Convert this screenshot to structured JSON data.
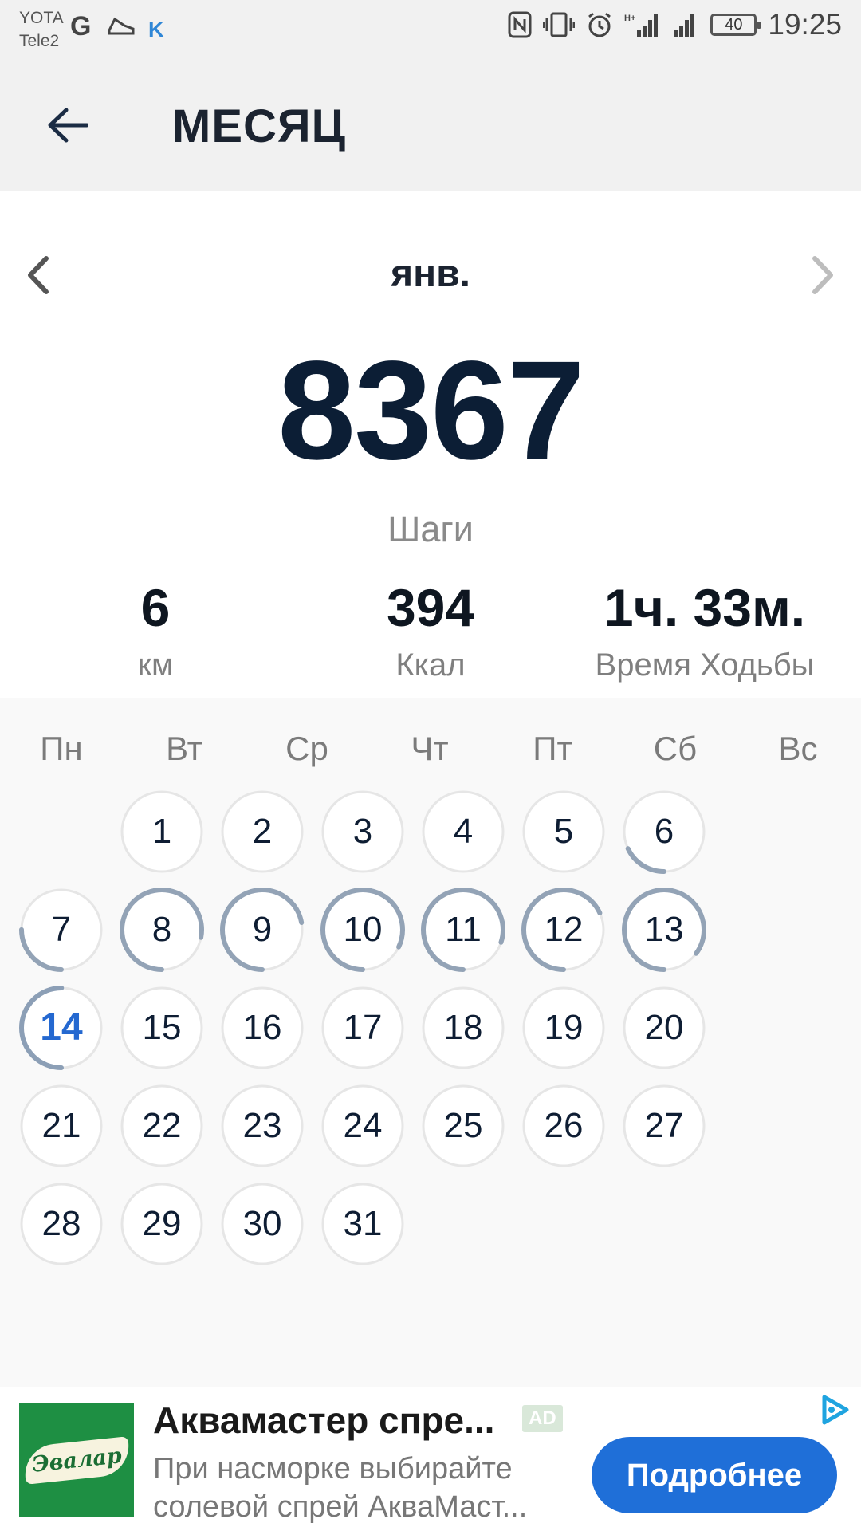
{
  "status_bar": {
    "carrier_1": "YOTA",
    "carrier_2": "Tele2",
    "google_icon": "G",
    "k_icon": "K",
    "battery": "40",
    "time": "19:25"
  },
  "app_bar": {
    "title": "МЕСЯЦ"
  },
  "summary": {
    "month": "янв.",
    "steps": "8367",
    "steps_label": "Шаги",
    "distance_value": "6",
    "distance_unit": "км",
    "calories_value": "394",
    "calories_unit": "Ккал",
    "walk_time_value": "1ч. 33м.",
    "walk_time_label": "Время Ходьбы"
  },
  "calendar": {
    "weekdays": [
      "Пн",
      "Вт",
      "Ср",
      "Чт",
      "Пт",
      "Сб",
      "Вс"
    ],
    "first_weekday_index": 1,
    "today": 14,
    "days": [
      {
        "n": "1",
        "p": 0
      },
      {
        "n": "2",
        "p": 0
      },
      {
        "n": "3",
        "p": 0
      },
      {
        "n": "4",
        "p": 0
      },
      {
        "n": "5",
        "p": 0
      },
      {
        "n": "6",
        "p": 0.18
      },
      {
        "n": "7",
        "p": 0.25
      },
      {
        "n": "8",
        "p": 0.78
      },
      {
        "n": "9",
        "p": 0.72
      },
      {
        "n": "10",
        "p": 0.82
      },
      {
        "n": "11",
        "p": 0.8
      },
      {
        "n": "12",
        "p": 0.68
      },
      {
        "n": "13",
        "p": 0.85
      },
      {
        "n": "14",
        "p": 0.5
      },
      {
        "n": "15",
        "p": 0
      },
      {
        "n": "16",
        "p": 0
      },
      {
        "n": "17",
        "p": 0
      },
      {
        "n": "18",
        "p": 0
      },
      {
        "n": "19",
        "p": 0
      },
      {
        "n": "20",
        "p": 0
      },
      {
        "n": "21",
        "p": 0
      },
      {
        "n": "22",
        "p": 0
      },
      {
        "n": "23",
        "p": 0
      },
      {
        "n": "24",
        "p": 0
      },
      {
        "n": "25",
        "p": 0
      },
      {
        "n": "26",
        "p": 0
      },
      {
        "n": "27",
        "p": 0
      },
      {
        "n": "28",
        "p": 0
      },
      {
        "n": "29",
        "p": 0
      },
      {
        "n": "30",
        "p": 0
      },
      {
        "n": "31",
        "p": 0
      }
    ]
  },
  "ad": {
    "logo_text": "Эвалар",
    "title": "Аквамастер спре...",
    "badge": "AD",
    "description": "При насморке выбирайте солевой спрей АкваМаст...",
    "button": "Подробнее"
  },
  "colors": {
    "ring_track": "#e6e6e6",
    "ring_progress": "#93a3b6",
    "today_ring": "#8c9fb6",
    "today_text": "#2468d0",
    "ad_button": "#1f6fd8"
  }
}
